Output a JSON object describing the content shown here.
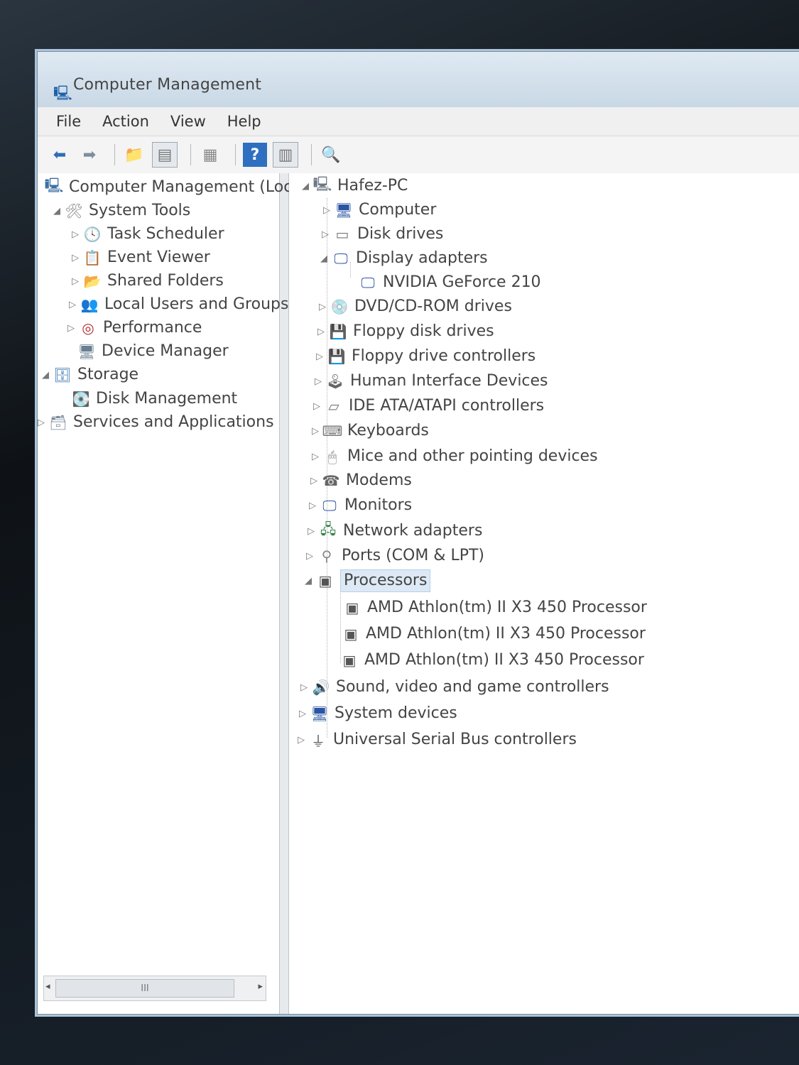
{
  "window": {
    "title": "Computer Management"
  },
  "menu": [
    "File",
    "Action",
    "View",
    "Help"
  ],
  "toolbar": {
    "icons": [
      "back-arrow-icon",
      "forward-arrow-icon",
      "up-folder-icon",
      "show-hide-tree-icon",
      "properties-icon",
      "help-icon",
      "action-pane-icon",
      "device-scan-icon"
    ]
  },
  "left_tree": [
    {
      "label": "Computer Management (Local",
      "icon": "computer-management-icon",
      "expander": ""
    },
    {
      "label": "System Tools",
      "icon": "tools-icon",
      "expander": "◢"
    },
    {
      "label": "Task Scheduler",
      "icon": "clock-icon",
      "expander": "▷"
    },
    {
      "label": "Event Viewer",
      "icon": "event-viewer-icon",
      "expander": "▷"
    },
    {
      "label": "Shared Folders",
      "icon": "shared-folder-icon",
      "expander": "▷"
    },
    {
      "label": "Local Users and Groups",
      "icon": "users-icon",
      "expander": "▷"
    },
    {
      "label": "Performance",
      "icon": "performance-icon",
      "expander": "▷"
    },
    {
      "label": "Device Manager",
      "icon": "device-manager-icon",
      "expander": ""
    },
    {
      "label": "Storage",
      "icon": "storage-icon",
      "expander": "◢"
    },
    {
      "label": "Disk Management",
      "icon": "disk-management-icon",
      "expander": ""
    },
    {
      "label": "Services and Applications",
      "icon": "services-icon",
      "expander": "▷"
    }
  ],
  "scrollbar": {
    "thumb_grip": "III"
  },
  "device_tree": [
    {
      "label": "Hafez-PC",
      "icon": "pc-icon",
      "expander": "◢"
    },
    {
      "label": "Computer",
      "icon": "computer-icon",
      "expander": "▷"
    },
    {
      "label": "Disk drives",
      "icon": "disk-drive-icon",
      "expander": "▷"
    },
    {
      "label": "Display adapters",
      "icon": "display-adapter-icon",
      "expander": "◢"
    },
    {
      "label": "NVIDIA GeForce 210",
      "icon": "display-adapter-icon",
      "expander": ""
    },
    {
      "label": "DVD/CD-ROM drives",
      "icon": "dvd-icon",
      "expander": "▷"
    },
    {
      "label": "Floppy disk drives",
      "icon": "floppy-icon",
      "expander": "▷"
    },
    {
      "label": "Floppy drive controllers",
      "icon": "floppy-controller-icon",
      "expander": "▷"
    },
    {
      "label": "Human Interface Devices",
      "icon": "hid-icon",
      "expander": "▷"
    },
    {
      "label": "IDE ATA/ATAPI controllers",
      "icon": "ide-icon",
      "expander": "▷"
    },
    {
      "label": "Keyboards",
      "icon": "keyboard-icon",
      "expander": "▷"
    },
    {
      "label": "Mice and other pointing devices",
      "icon": "mouse-icon",
      "expander": "▷"
    },
    {
      "label": "Modems",
      "icon": "modem-icon",
      "expander": "▷"
    },
    {
      "label": "Monitors",
      "icon": "monitor-icon",
      "expander": "▷"
    },
    {
      "label": "Network adapters",
      "icon": "network-icon",
      "expander": "▷"
    },
    {
      "label": "Ports (COM & LPT)",
      "icon": "port-icon",
      "expander": "▷"
    },
    {
      "label": "Processors",
      "icon": "processor-icon",
      "expander": "◢"
    },
    {
      "label": "AMD Athlon(tm) II X3 450 Processor",
      "icon": "processor-icon",
      "expander": ""
    },
    {
      "label": "AMD Athlon(tm) II X3 450 Processor",
      "icon": "processor-icon",
      "expander": ""
    },
    {
      "label": "AMD Athlon(tm) II X3 450 Processor",
      "icon": "processor-icon",
      "expander": ""
    },
    {
      "label": "Sound, video and game controllers",
      "icon": "sound-icon",
      "expander": "▷"
    },
    {
      "label": "System devices",
      "icon": "system-devices-icon",
      "expander": "▷"
    },
    {
      "label": "Universal Serial Bus controllers",
      "icon": "usb-icon",
      "expander": "▷"
    }
  ]
}
